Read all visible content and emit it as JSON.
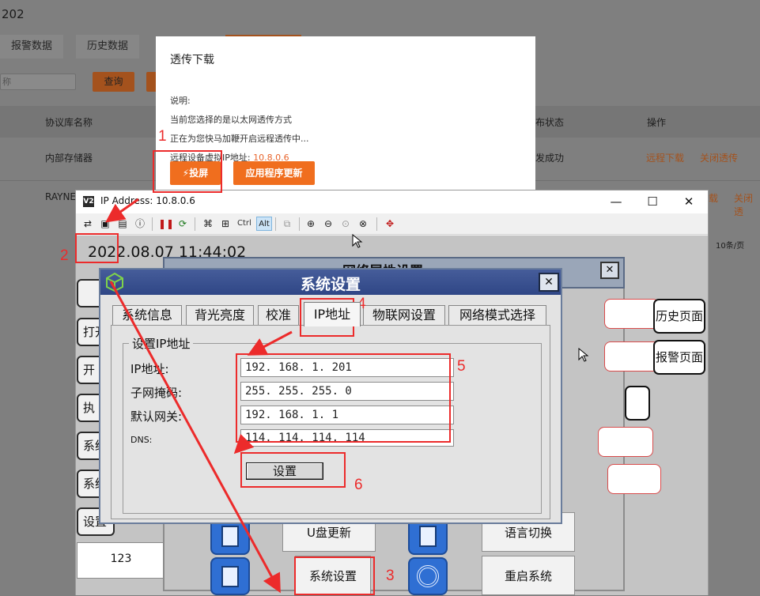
{
  "web": {
    "title": "202",
    "tabs": [
      "报警数据",
      "历史数据"
    ],
    "search_placeholder": "称",
    "query_button": "查询",
    "columns": [
      "协议库名称",
      "布状态",
      "操作"
    ],
    "rows": [
      {
        "name": "内部存储器",
        "status": "发成功",
        "action1": "远程下载",
        "action2": "关闭透传"
      },
      {
        "name": "RAYNE",
        "status": "",
        "action1": "载",
        "action2": "关闭透"
      }
    ],
    "page_size": "10条/页"
  },
  "modal": {
    "title": "透传下载",
    "desc_label": "说明:",
    "line1": "当前您选择的是以太网透传方式",
    "line2": "正在为您快马加鞭开启远程透传中...",
    "line3_prefix": "远程设备虚拟IP地址: ",
    "line3_ip": "10.8.0.6",
    "btn_screen": "⚡投屏",
    "btn_update": "应用程序更新"
  },
  "vnc": {
    "logo": "V2",
    "title": "IP Address:  10.8.0.6",
    "controls": {
      "minimize": "—",
      "maximize": "☐",
      "close": "✕"
    },
    "toolbar": {
      "ctrl": "Ctrl",
      "alt": "Alt"
    }
  },
  "hmi": {
    "clock": "2022.08.07 11:44:02",
    "background_window_title": "网络属性设置",
    "left_buttons": [
      "",
      "打开",
      "开",
      "执",
      "系统",
      "系统",
      "设置"
    ],
    "right_buttons": [
      "历史页面",
      "报警页面"
    ],
    "bottom_buttons": [
      "U盘更新",
      "语言切换",
      "系统设置",
      "重启系统"
    ],
    "value_display": "123"
  },
  "system_settings": {
    "title": "系统设置",
    "close": "✕",
    "tabs": [
      "系统信息",
      "背光亮度",
      "校准",
      "IP地址",
      "物联网设置",
      "网络模式选择"
    ],
    "active_tab": "IP地址",
    "group_label": "设置IP地址",
    "fields": [
      {
        "label": "IP地址:",
        "value": "192. 168. 1. 201"
      },
      {
        "label": "子网掩码:",
        "value": "255. 255. 255. 0"
      },
      {
        "label": "默认网关:",
        "value": "192. 168. 1. 1"
      },
      {
        "label": "DNS:",
        "value": "114. 114. 114. 114"
      }
    ],
    "set_button": "设置"
  },
  "annotations": {
    "numbers": [
      "1",
      "2",
      "3",
      "4",
      "5",
      "6"
    ],
    "color": "#ec2b2b"
  },
  "colors": {
    "accent_orange": "#f06e1e",
    "overlay_orange": "#a4521d",
    "dialog_title_blue": "#2f4686",
    "hmi_icon_blue": "#2f6fd3"
  }
}
